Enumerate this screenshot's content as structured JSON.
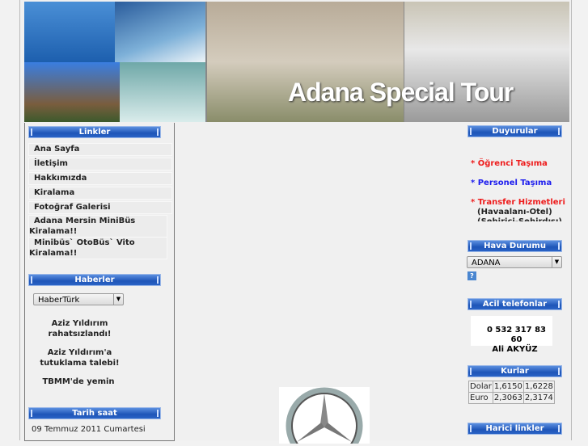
{
  "banner": {
    "title": "Adana Special Tour"
  },
  "linkler": {
    "header": "Linkler",
    "items": [
      "Ana Sayfa",
      "İletişim",
      "Hakkımızda",
      "Kiralama",
      "Fotoğraf Galerisi",
      "Adana Mersin MiniBüs Kiralama!!",
      "Minibüs` OtoBüs` Vito Kiralama!!"
    ]
  },
  "haberler": {
    "header": "Haberler",
    "source": "HaberTürk",
    "items": [
      "Aziz Yıldırım rahatsızlandı!",
      "Aziz Yıldırım'a tutuklama talebi!",
      "TBMM'de yemin"
    ]
  },
  "tarih": {
    "header": "Tarih saat",
    "date": "09 Temmuz 2011 Cumartesi"
  },
  "duyurular": {
    "header": "Duyurular",
    "items": [
      {
        "text": "* Öğrenci Taşıma",
        "color": "#ee1c1c"
      },
      {
        "text": "* Personel Taşıma",
        "color": "#1c1cee"
      },
      {
        "text": "* Transfer Hizmetleri",
        "color": "#ee1c1c"
      }
    ],
    "sub1": "(Havaalanı-Otel)",
    "sub2": "(Şehirici-Şehirdışı)"
  },
  "hava": {
    "header": "Hava Durumu",
    "city": "ADANA",
    "help": "?"
  },
  "acil": {
    "header": "Acil telefonlar",
    "phone": "0 532 317 83 60",
    "name": "Ali AKYÜZ"
  },
  "kurlar": {
    "header": "Kurlar",
    "rows": [
      [
        "Dolar",
        "1,6150",
        "1,6228"
      ],
      [
        "Euro",
        "2,3063",
        "2,3174"
      ]
    ]
  },
  "harici": {
    "header": "Harici linkler"
  }
}
